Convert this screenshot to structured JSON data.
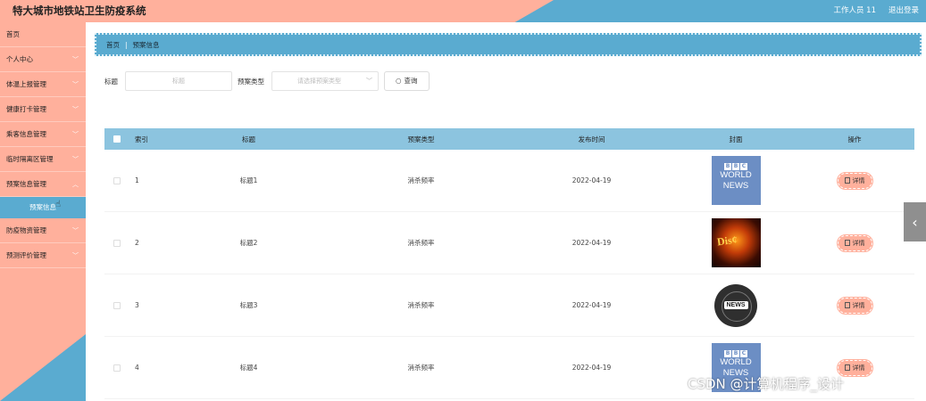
{
  "header": {
    "title": "特大城市地铁站卫生防疫系统",
    "user_label": "工作人员 11",
    "logout_label": "退出登录",
    "colors": {
      "salmon": "#ffb09c",
      "blue": "#5aabd0"
    }
  },
  "sidebar": {
    "items": [
      {
        "label": "首页"
      },
      {
        "label": "个人中心"
      },
      {
        "label": "体温上报管理"
      },
      {
        "label": "健康打卡管理"
      },
      {
        "label": "乘客信息管理"
      },
      {
        "label": "临时隔离区管理"
      },
      {
        "label": "预案信息管理"
      },
      {
        "label": "防疫物资管理"
      },
      {
        "label": "预测评价管理"
      }
    ],
    "active_sub": "预案信息"
  },
  "breadcrumb": {
    "home": "首页",
    "current": "预案信息"
  },
  "search": {
    "title_label": "标题",
    "title_placeholder": "标题",
    "type_label": "预案类型",
    "type_placeholder": "请选择预案类型",
    "query_button": "查询"
  },
  "table": {
    "headers": {
      "index": "索引",
      "title": "标题",
      "type": "预案类型",
      "time": "发布时间",
      "cover": "封面",
      "op": "操作"
    },
    "rows": [
      {
        "index": "1",
        "title": "标题1",
        "type": "消杀频率",
        "time": "2022-04-19",
        "cover": "bbc",
        "detail": "详情"
      },
      {
        "index": "2",
        "title": "标题2",
        "type": "消杀频率",
        "time": "2022-04-19",
        "cover": "fire",
        "detail": "详情"
      },
      {
        "index": "3",
        "title": "标题3",
        "type": "消杀频率",
        "time": "2022-04-19",
        "cover": "globe",
        "detail": "详情"
      },
      {
        "index": "4",
        "title": "标题4",
        "type": "消杀频率",
        "time": "2022-04-19",
        "cover": "bbc",
        "detail": "详情"
      }
    ],
    "covers": {
      "bbc": {
        "blocks": [
          "B",
          "B",
          "C"
        ],
        "line1": "WORLD",
        "line2": "NEWS"
      },
      "fire": {
        "text": "Dis¢"
      },
      "globe": {
        "tag": "NEWS"
      }
    }
  },
  "watermark": "CSDN @计算机程序_设计"
}
